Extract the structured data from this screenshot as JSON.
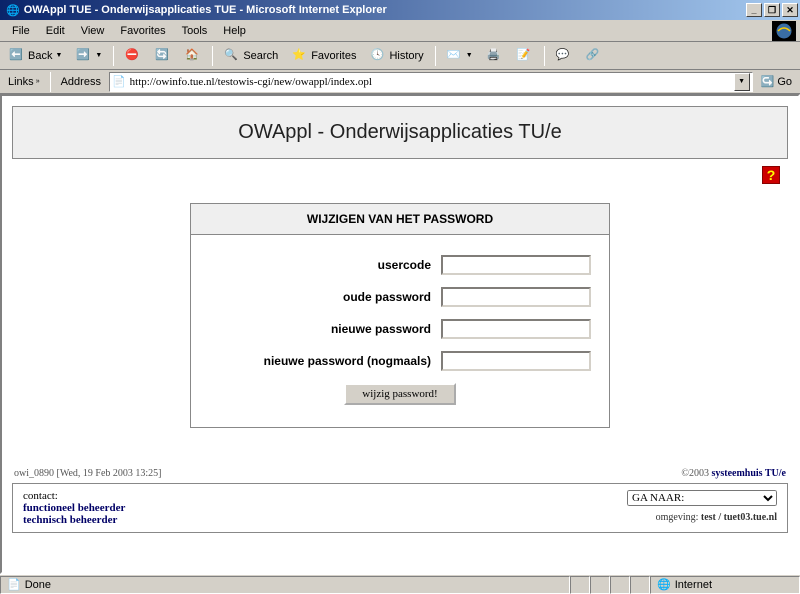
{
  "window": {
    "title": "OWAppl TUE - Onderwijsapplicaties TUE - Microsoft Internet Explorer",
    "minimize": "_",
    "maximize": "❐",
    "close": "✕"
  },
  "menu": {
    "file": "File",
    "edit": "Edit",
    "view": "View",
    "favorites": "Favorites",
    "tools": "Tools",
    "help": "Help"
  },
  "toolbar": {
    "back": "Back",
    "search": "Search",
    "favorites": "Favorites",
    "history": "History"
  },
  "address": {
    "links_label": "Links",
    "address_label": "Address",
    "url": "http://owinfo.tue.nl/testowis-cgi/new/owappl/index.opl",
    "go": "Go"
  },
  "page": {
    "heading": "OWAppl - Onderwijsapplicaties TU/e",
    "help_symbol": "?",
    "form": {
      "title": "WIJZIGEN VAN HET PASSWORD",
      "usercode_label": "usercode",
      "oldpw_label": "oude password",
      "newpw_label": "nieuwe password",
      "newpw2_label": "nieuwe password (nogmaals)",
      "submit": "wijzig password!",
      "usercode": "",
      "oldpw": "",
      "newpw": "",
      "newpw2": ""
    },
    "footer_left": "owi_0890 [Wed, 19 Feb 2003 13:25]",
    "footer_right_prefix": "©2003 ",
    "footer_right_link": "systeemhuis TU/e",
    "contact": {
      "label": "contact:",
      "func": "functioneel beheerder",
      "tech": "technisch beheerder",
      "select": "GA NAAR:",
      "omgeving_label": "omgeving: ",
      "omgeving_val": "test / tuet03.tue.nl"
    }
  },
  "status": {
    "done": "Done",
    "zone": "Internet"
  }
}
